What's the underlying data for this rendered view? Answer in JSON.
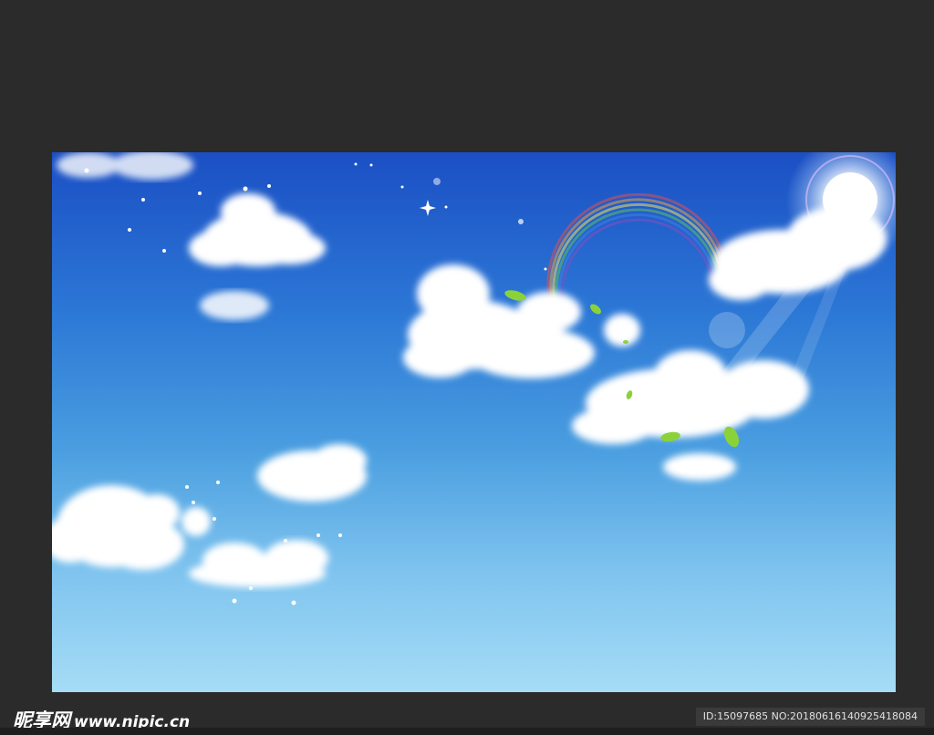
{
  "scene": {
    "subject": "sky-with-clouds-rainbow-sun",
    "colors": {
      "frame": "#2b2b2b",
      "sky_top": "#1b4fc4",
      "sky_bottom": "#a6dcf6",
      "cloud": "#ffffff",
      "leaf": "#7ed321"
    }
  },
  "watermark": {
    "site_name_cn": "昵享网",
    "site_url": "www.nipic.cn",
    "id_text": "ID:15097685 NO:20180616140925418084"
  }
}
